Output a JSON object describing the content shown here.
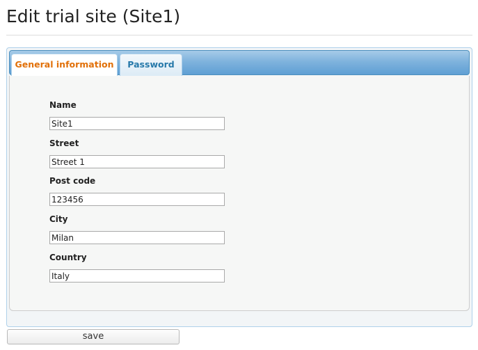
{
  "page": {
    "title": "Edit trial site (Site1)"
  },
  "tabs": [
    {
      "label": "General information",
      "active": true
    },
    {
      "label": "Password",
      "active": false
    }
  ],
  "form": {
    "fields": [
      {
        "label": "Name",
        "value": "Site1"
      },
      {
        "label": "Street",
        "value": "Street 1"
      },
      {
        "label": "Post code",
        "value": "123456"
      },
      {
        "label": "City",
        "value": "Milan"
      },
      {
        "label": "Country",
        "value": "Italy"
      }
    ]
  },
  "actions": {
    "save_label": "save"
  },
  "colors": {
    "active_tab_text": "#e17009",
    "inactive_tab_text": "#2779aa",
    "tab_strip": "#5f9fd4",
    "panel_border": "#aed0ea"
  }
}
